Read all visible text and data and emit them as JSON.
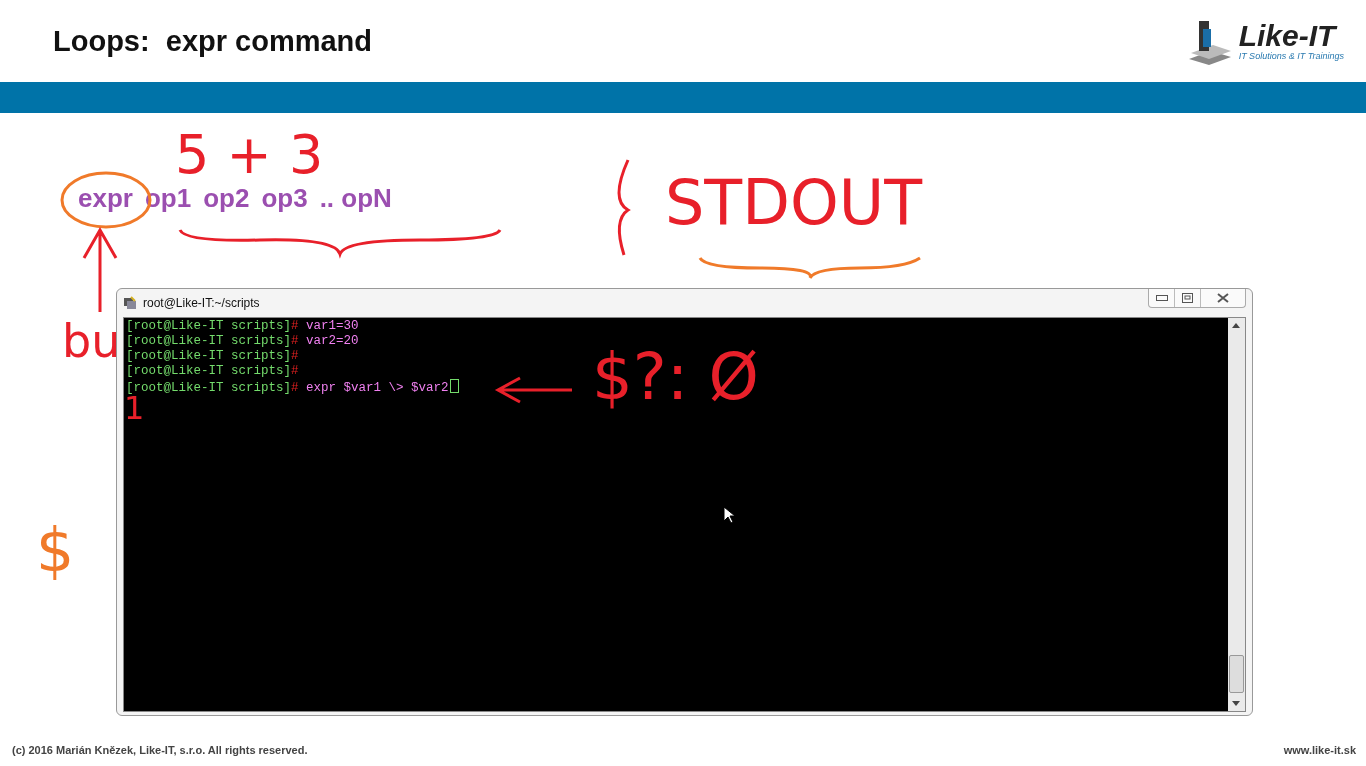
{
  "slide": {
    "title": "Loops:  expr command",
    "logo": {
      "name": "Like-IT",
      "tagline": "IT Solutions & IT Trainings"
    },
    "syntax": [
      "expr",
      "op1",
      "op2",
      "op3",
      ".. opN"
    ],
    "footer": {
      "copyright": "(c) 2016 Marián Knězek, Like-IT, s.r.o. All rights reserved.",
      "url": "www.like-it.sk"
    }
  },
  "terminal": {
    "title": "root@Like-IT:~/scripts",
    "lines": [
      {
        "prompt": "[root@Like-IT scripts]",
        "symbol": "#",
        "command": "var1=30",
        "cursor": false
      },
      {
        "prompt": "[root@Like-IT scripts]",
        "symbol": "#",
        "command": "var2=20",
        "cursor": false
      },
      {
        "prompt": "[root@Like-IT scripts]",
        "symbol": "#",
        "cursor": false
      },
      {
        "prompt": "[root@Like-IT scripts]",
        "symbol": "#",
        "cursor": false
      },
      {
        "prompt": "[root@Like-IT scripts]",
        "symbol": "#",
        "command": "expr $var1 \\> $var2",
        "cursor": true
      }
    ]
  },
  "annotations": [
    {
      "text": "5 + 3",
      "color": "#e8202a"
    },
    {
      "text": "STDOUT",
      "color": "#e8202a"
    },
    {
      "text": "$?: Ø",
      "color": "#e8202a"
    },
    {
      "text": "bu",
      "color": "#e8202a"
    },
    {
      "text": "$",
      "color": "#f07a2a"
    },
    {
      "text": "1",
      "color": "#e8202a"
    }
  ]
}
